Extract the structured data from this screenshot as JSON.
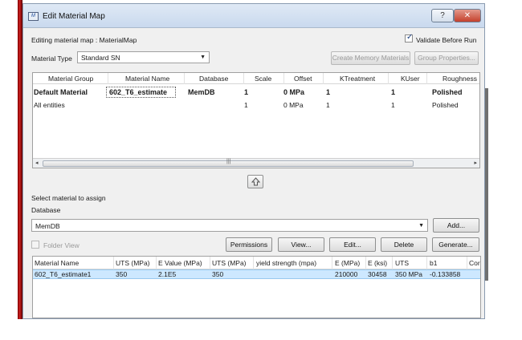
{
  "window": {
    "title": "Edit Material Map"
  },
  "editing": {
    "label": "Editing material map :",
    "map_name": "MaterialMap"
  },
  "validate": {
    "label": "Validate Before Run",
    "checked": true
  },
  "material_type": {
    "label": "Material Type",
    "value": "Standard SN"
  },
  "buttons": {
    "create_memory": "Create Memory Materials",
    "group_properties": "Group Properties...",
    "add": "Add...",
    "permissions": "Permissions",
    "view": "View...",
    "edit": "Edit...",
    "delete": "Delete",
    "generate": "Generate..."
  },
  "groups_table": {
    "columns": [
      "Material Group",
      "Material Name",
      "Database",
      "Scale",
      "Offset",
      "KTreatment",
      "KUser",
      "Roughness"
    ],
    "rows": [
      {
        "group": "Default Material",
        "name": "602_T6_estimate",
        "database": "MemDB",
        "scale": "1",
        "offset": "0 MPa",
        "ktreatment": "1",
        "kuser": "1",
        "roughness": "Polished"
      },
      {
        "group": "All entities",
        "name": "",
        "database": "",
        "scale": "1",
        "offset": "0 MPa",
        "ktreatment": "1",
        "kuser": "1",
        "roughness": "Polished"
      }
    ]
  },
  "assign": {
    "label": "Select material to assign",
    "database_label": "Database",
    "database_value": "MemDB"
  },
  "folder_view": {
    "label": "Folder View",
    "checked": false
  },
  "materials_table": {
    "columns": [
      "Material Name",
      "UTS (MPa)",
      "E Value (MPa)",
      "UTS (MPa)",
      "yield strength (mpa)",
      "E (MPa)",
      "E (ksi)",
      "UTS",
      "b1",
      "Cor"
    ],
    "rows": [
      {
        "cells": [
          "602_T6_estimate1",
          "350",
          "2.1E5",
          "350",
          "",
          "210000",
          "30458",
          "350 MPa",
          "-0.133858",
          ""
        ]
      }
    ]
  },
  "icons": {
    "app": "material-map-app-icon",
    "help": "help-icon",
    "close": "close-icon",
    "up": "up-arrow-icon"
  },
  "colors": {
    "selection": "#cde8ff",
    "titlebar": "#c9d9ee",
    "close": "#c4402c"
  }
}
